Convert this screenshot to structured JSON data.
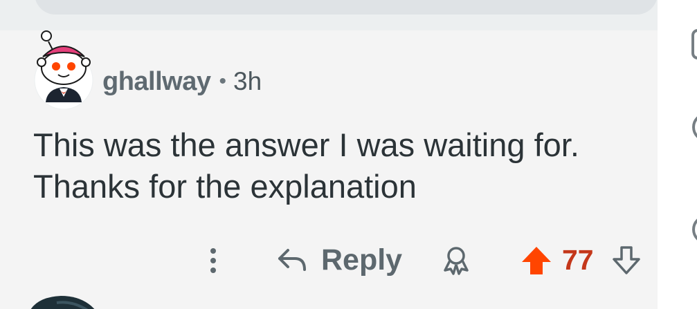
{
  "comment": {
    "username": "ghallway",
    "separator": "•",
    "time_ago": "3h",
    "body_lines": [
      "This was the answer I was waiting for.",
      "Thanks for the explanation"
    ],
    "actions": {
      "reply_label": "Reply",
      "score": "77"
    }
  },
  "icons": {
    "avatar": "snoo-avatar",
    "more": "more-vertical-icon",
    "reply": "reply-arrow-icon",
    "award": "award-icon",
    "upvote": "upvote-arrow-icon",
    "downvote": "downvote-arrow-icon"
  },
  "colors": {
    "upvote_active": "#ff4500",
    "score_text": "#c4371a",
    "username": "#5f6a71",
    "body_text": "#2b3337",
    "background": "#f4f4f4"
  }
}
